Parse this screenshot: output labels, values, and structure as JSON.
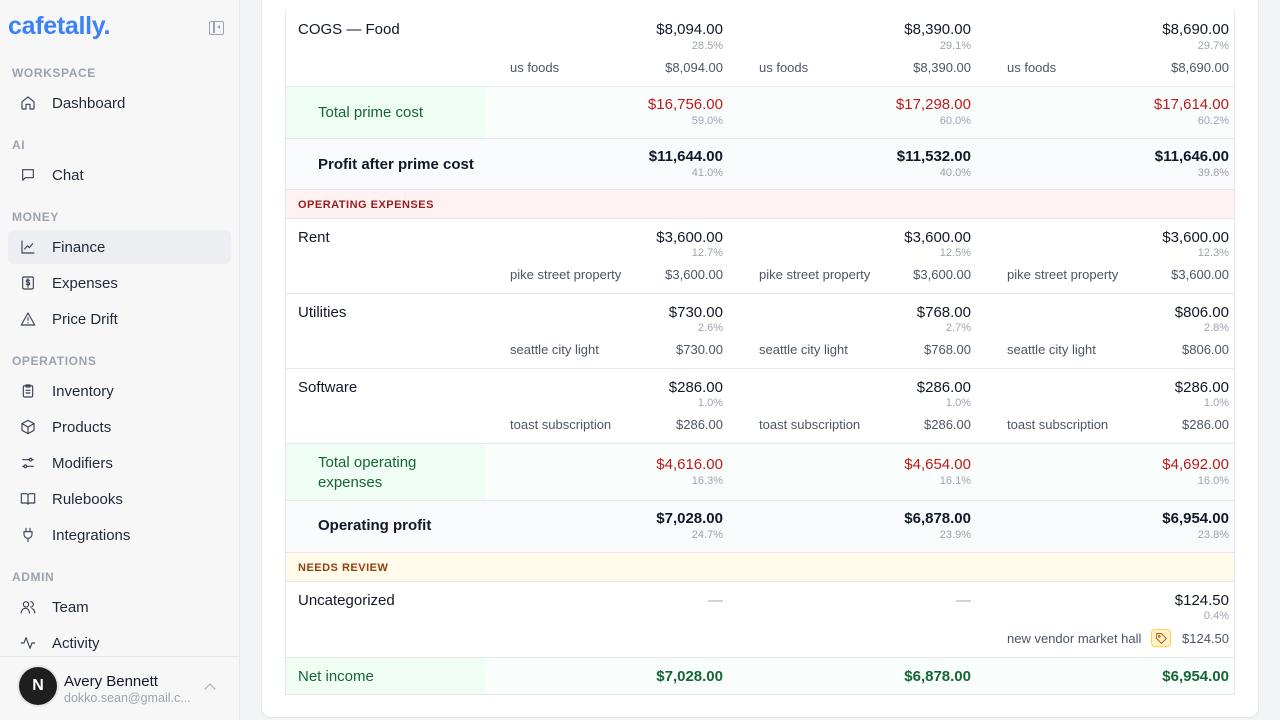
{
  "brand": "cafetally.",
  "sidebar": {
    "sections": [
      {
        "label": "WORKSPACE",
        "items": [
          {
            "label": "Dashboard",
            "icon": "home-icon"
          }
        ]
      },
      {
        "label": "AI",
        "items": [
          {
            "label": "Chat",
            "icon": "chat-icon"
          }
        ]
      },
      {
        "label": "MONEY",
        "items": [
          {
            "label": "Finance",
            "icon": "chart-line-icon",
            "active": true
          },
          {
            "label": "Expenses",
            "icon": "receipt-dollar-icon"
          },
          {
            "label": "Price Drift",
            "icon": "warning-triangle-icon"
          }
        ]
      },
      {
        "label": "OPERATIONS",
        "items": [
          {
            "label": "Inventory",
            "icon": "clipboard-icon"
          },
          {
            "label": "Products",
            "icon": "box-icon"
          },
          {
            "label": "Modifiers",
            "icon": "sliders-icon"
          },
          {
            "label": "Rulebooks",
            "icon": "book-icon"
          },
          {
            "label": "Integrations",
            "icon": "plug-icon"
          }
        ]
      },
      {
        "label": "ADMIN",
        "items": [
          {
            "label": "Team",
            "icon": "users-icon"
          },
          {
            "label": "Activity",
            "icon": "activity-icon"
          }
        ]
      }
    ]
  },
  "user": {
    "initial": "N",
    "name": "Avery Bennett",
    "email": "dokko.sean@gmail.c..."
  },
  "table": {
    "cogs_food": {
      "label": "COGS — Food",
      "values": [
        "$8,094.00",
        "$8,390.00",
        "$8,690.00"
      ],
      "pcts": [
        "28.5%",
        "29.1%",
        "29.7%"
      ],
      "vendor": "us foods",
      "vendor_values": [
        "$8,094.00",
        "$8,390.00",
        "$8,690.00"
      ]
    },
    "total_prime": {
      "label": "Total prime cost",
      "values": [
        "$16,756.00",
        "$17,298.00",
        "$17,614.00"
      ],
      "pcts": [
        "59.0%",
        "60.0%",
        "60.2%"
      ]
    },
    "profit_prime": {
      "label": "Profit after prime cost",
      "values": [
        "$11,644.00",
        "$11,532.00",
        "$11,646.00"
      ],
      "pcts": [
        "41.0%",
        "40.0%",
        "39.8%"
      ]
    },
    "opex_header": "OPERATING EXPENSES",
    "rent": {
      "label": "Rent",
      "values": [
        "$3,600.00",
        "$3,600.00",
        "$3,600.00"
      ],
      "pcts": [
        "12.7%",
        "12.5%",
        "12.3%"
      ],
      "vendor": "pike street property",
      "vendor_values": [
        "$3,600.00",
        "$3,600.00",
        "$3,600.00"
      ]
    },
    "utilities": {
      "label": "Utilities",
      "values": [
        "$730.00",
        "$768.00",
        "$806.00"
      ],
      "pcts": [
        "2.6%",
        "2.7%",
        "2.8%"
      ],
      "vendor": "seattle city light",
      "vendor_values": [
        "$730.00",
        "$768.00",
        "$806.00"
      ]
    },
    "software": {
      "label": "Software",
      "values": [
        "$286.00",
        "$286.00",
        "$286.00"
      ],
      "pcts": [
        "1.0%",
        "1.0%",
        "1.0%"
      ],
      "vendor": "toast subscription",
      "vendor_values": [
        "$286.00",
        "$286.00",
        "$286.00"
      ]
    },
    "total_opex": {
      "label_line1": "Total operating",
      "label_line2": "expenses",
      "values": [
        "$4,616.00",
        "$4,654.00",
        "$4,692.00"
      ],
      "pcts": [
        "16.3%",
        "16.1%",
        "16.0%"
      ]
    },
    "op_profit": {
      "label": "Operating profit",
      "values": [
        "$7,028.00",
        "$6,878.00",
        "$6,954.00"
      ],
      "pcts": [
        "24.7%",
        "23.9%",
        "23.8%"
      ]
    },
    "review_header": "NEEDS REVIEW",
    "uncategorized": {
      "label": "Uncategorized",
      "values": [
        "—",
        "—",
        "$124.50"
      ],
      "pct": "0.4%",
      "vendor": "new vendor market hall",
      "vendor_value": "$124.50"
    },
    "net_income": {
      "label": "Net income",
      "values": [
        "$7,028.00",
        "$6,878.00",
        "$6,954.00"
      ]
    }
  }
}
